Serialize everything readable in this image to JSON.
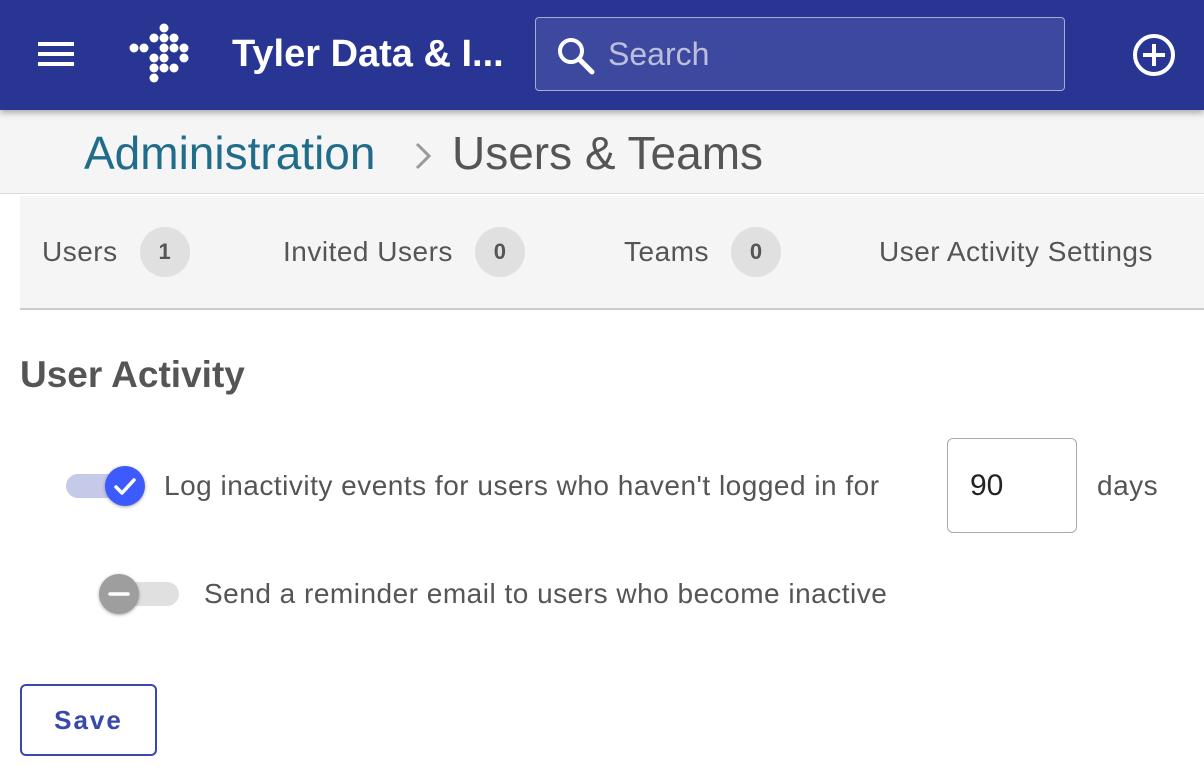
{
  "header": {
    "title": "Tyler Data & I...",
    "menu_icon": "hamburger-menu-icon",
    "logo_icon": "tyler-diamond-dots-logo",
    "add_icon": "add-circle-icon",
    "background": "#283593"
  },
  "search": {
    "placeholder": "Search",
    "value": "",
    "icon": "search-icon"
  },
  "breadcrumb": {
    "parent": "Administration",
    "current": "Users & Teams",
    "separator_icon": "chevron-right-icon"
  },
  "tabs": [
    {
      "label": "Users",
      "count": "1"
    },
    {
      "label": "Invited Users",
      "count": "0"
    },
    {
      "label": "Teams",
      "count": "0"
    },
    {
      "label": "User Activity Settings"
    }
  ],
  "section": {
    "title": "User Activity"
  },
  "settings": {
    "inactivity": {
      "enabled": true,
      "label": "Log inactivity events for users who haven't logged in for",
      "days_value": "90",
      "unit": "days",
      "icon": "check-icon"
    },
    "reminder": {
      "enabled": false,
      "label": "Send a reminder email to users who become inactive",
      "icon": "minus-icon"
    }
  },
  "actions": {
    "save_label": "Save"
  },
  "colors": {
    "accent": "#3d5afe",
    "link": "#1f6d8a",
    "button": "#3949ab"
  }
}
